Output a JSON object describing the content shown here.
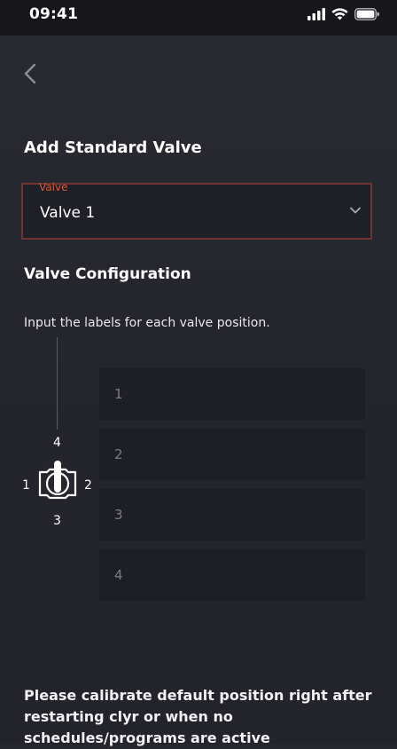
{
  "status_bar": {
    "time": "09:41",
    "icons": [
      "signal-icon",
      "wifi-icon",
      "battery-icon"
    ]
  },
  "nav": {
    "back_icon": "chevron-left-icon"
  },
  "page": {
    "title": "Add Standard Valve"
  },
  "valve_select": {
    "label": "Valve",
    "value": "Valve 1",
    "icon": "chevron-down-icon"
  },
  "configuration": {
    "title": "Valve Configuration",
    "instructions": "Input the labels for each valve position.",
    "diagram_labels": {
      "top": "4",
      "left": "1",
      "right": "2",
      "bottom": "3"
    },
    "fields": [
      {
        "placeholder": "1"
      },
      {
        "placeholder": "2"
      },
      {
        "placeholder": "3"
      },
      {
        "placeholder": "4"
      }
    ]
  },
  "warning": {
    "text": "Please calibrate default position right after restarting clyr or when no schedules/programs are active"
  },
  "colors": {
    "background": "#26262e",
    "field_background": "#1e1f25",
    "accent": "#d6553d",
    "select_border": "#6e3530",
    "status_bar": "#17171b"
  }
}
